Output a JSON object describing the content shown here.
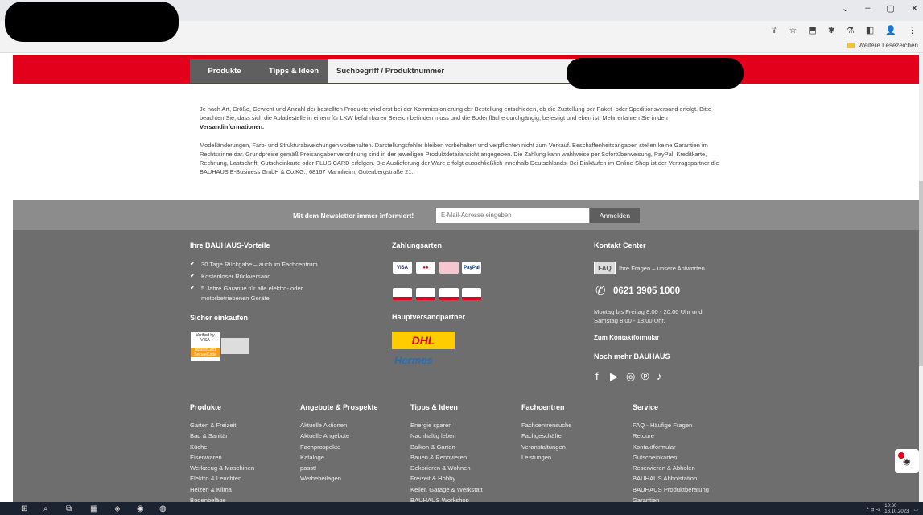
{
  "browser": {
    "controls": [
      "⌄",
      "–",
      "▢",
      "✕"
    ],
    "nav": [
      "←",
      "→"
    ],
    "toolbar_icons": [
      "⇪",
      "☆",
      "⬒",
      "✱",
      "⚗",
      "◧",
      "👤",
      "⋮"
    ],
    "bookmarks_other": "Weitere Lesezeichen"
  },
  "nav": {
    "tabs": [
      "Produkte",
      "Tipps & Ideen"
    ],
    "search_tab": "Suchbegriff / Produktnummer"
  },
  "info": {
    "p1": "Je nach Art, Größe, Gewicht und Anzahl der bestellten Produkte wird erst bei der Kommissionierung der Bestellung entschieden, ob die Zustellung per Paket- oder Speditionsversand erfolgt. Bitte beachten Sie, dass sich die Abladestelle in einem für LKW befahrbaren Bereich befinden muss und die Bodenfläche durchgängig, befestigt und eben ist. Mehr erfahren Sie in den",
    "p1_link": "Versandinformationen.",
    "p2": "Modelländerungen, Farb- und Strukturabweichungen vorbehalten. Darstellungsfehler bleiben vorbehalten und verpflichten nicht zum Verkauf. Beschaffenheitsangaben stellen keine Garantien im Rechtssinne dar. Grundpreise gemäß Preisangabenverordnung sind in der jeweiligen Produktdetailansicht angegeben. Die Zahlung kann wahlweise per Sofortüberweisung, PayPal, Kreditkarte, Rechnung, Lastschrift, Gutscheinkarte oder PLUS CARD erfolgen. Die Auslieferung der Ware erfolgt ausschließlich innerhalb Deutschlands. Bei Einkäufen im Online-Shop ist der Vertragspartner die BAUHAUS E-Business GmbH & Co.KG., 68167 Mannheim, Gutenbergstraße 21."
  },
  "newsletter": {
    "label": "Mit dem Newsletter immer informiert!",
    "placeholder": "E-Mail-Adresse eingeben",
    "button": "Anmelden"
  },
  "vorteile": {
    "title": "Ihre BAUHAUS-Vorteile",
    "items": [
      "30 Tage Rückgabe – auch im Fachcentrum",
      "Kostenloser Rückversand",
      "5 Jahre Garantie für alle elektro- oder",
      "motorbetriebenen Geräte"
    ],
    "secure_title": "Sicher einkaufen",
    "visa_badge": "Verified by VISA",
    "mc_badge": "MasterCard SecureCode"
  },
  "zahlung": {
    "title": "Zahlungsarten",
    "row1": [
      "VISA",
      "MC",
      "",
      "PayPal"
    ],
    "row2": [
      "",
      "",
      "",
      ""
    ],
    "partner_title": "Hauptversandpartner",
    "dhl": "DHL",
    "hermes": "Hermes"
  },
  "kontakt": {
    "title": "Kontakt Center",
    "faq": "FAQ",
    "faq_text": "Ihre Fragen – unsere Antworten",
    "phone": "0621 3905 1000",
    "hours1": "Montag bis Freitag 8:00 - 20:00 Uhr und",
    "hours2": "Samstag 8:00 - 18:00 Uhr.",
    "form_link": "Zum Kontaktformular",
    "more_title": "Noch mehr BAUHAUS",
    "social": [
      "f",
      "▶",
      "◎",
      "℗",
      "♪"
    ]
  },
  "columns": [
    {
      "title": "Produkte",
      "items": [
        "Garten & Freizeit",
        "Bad & Sanitär",
        "Küche",
        "Eisenwaren",
        "Werkzeug & Maschinen",
        "Elektro & Leuchten",
        "Heizen & Klima",
        "Bodenbeläge"
      ]
    },
    {
      "title": "Angebote & Prospekte",
      "items": [
        "Aktuelle Aktionen",
        "Aktuelle Angebote",
        "Fachprospekte",
        "Kataloge",
        "passt!",
        "Werbebeilagen"
      ]
    },
    {
      "title": "Tipps & Ideen",
      "items": [
        "Energie sparen",
        "Nachhaltig leben",
        "Balkon & Garten",
        "Bauen & Renovieren",
        "Dekorieren & Wohnen",
        "Freizeit & Hobby",
        "Keller, Garage & Werkstatt",
        "BAUHAUS Workshop"
      ]
    },
    {
      "title": "Fachcentren",
      "items": [
        "Fachcentrensuche",
        "Fachgeschäfte",
        "Veranstaltungen",
        "Leistungen"
      ]
    },
    {
      "title": "Service",
      "items": [
        "FAQ - Häufige Fragen",
        "Retoure",
        "Kontaktformular",
        "Gutscheinkarten",
        "Reservieren & Abholen",
        "BAUHAUS Abholstation",
        "BAUHAUS Produktberatung",
        "Garantien"
      ]
    }
  ],
  "taskbar": {
    "apps": [
      "⊞",
      "⌕",
      "⧉",
      "▦",
      "◈",
      "◉",
      "◍"
    ],
    "tray_icons": "^ ⊡ ⊲",
    "time": "10:30",
    "date": "18.10.2023"
  },
  "colors": {
    "accent": "#e3001b",
    "footer": "#6e6e6e",
    "newsletter": "#8c8c8c"
  }
}
